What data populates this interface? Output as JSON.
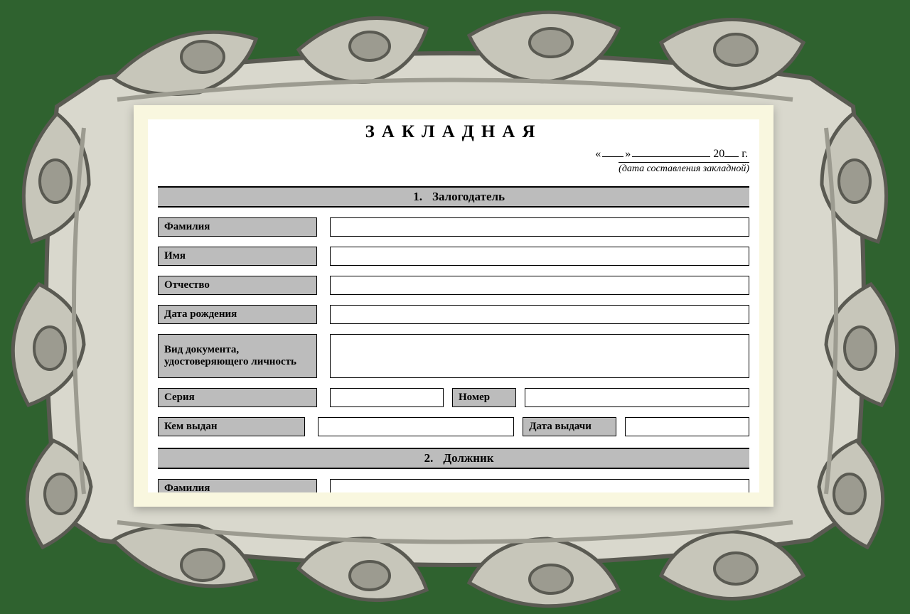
{
  "title": "ЗАКЛАДНАЯ",
  "date": {
    "open_quote": "«",
    "close_quote": "»",
    "year_prefix": "20",
    "year_suffix": "г.",
    "caption": "(дата составления закладной)"
  },
  "sections": [
    {
      "num": "1.",
      "title": "Залогодатель",
      "fields": {
        "surname": "Фамилия",
        "name": "Имя",
        "patronymic": "Отчество",
        "dob": "Дата рождения",
        "id_doc": "Вид документа, удостоверяющего личность",
        "series": "Серия",
        "number": "Номер",
        "issued_by": "Кем выдан",
        "issue_date": "Дата выдачи"
      }
    },
    {
      "num": "2.",
      "title": "Должник",
      "fields": {
        "surname": "Фамилия"
      }
    }
  ]
}
